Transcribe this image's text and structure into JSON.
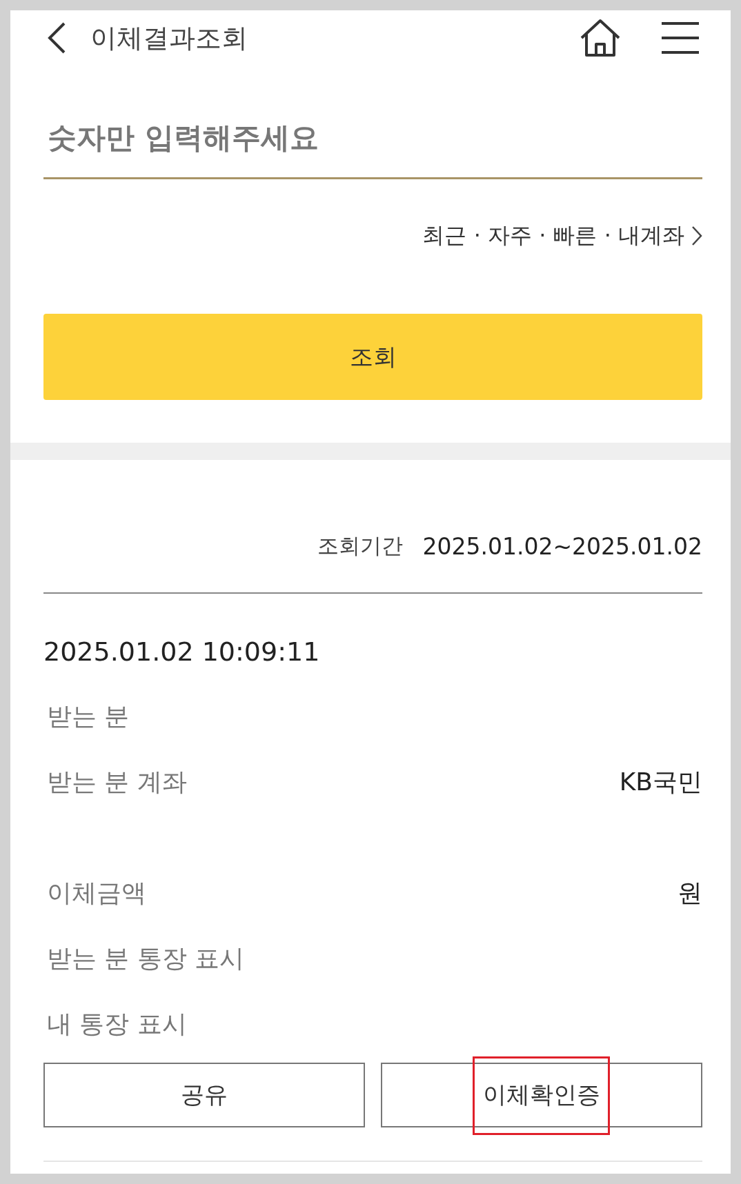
{
  "header": {
    "title": "이체결과조회"
  },
  "account_input": {
    "placeholder": "숫자만 입력해주세요"
  },
  "quick_links": {
    "items": [
      "최근",
      "자주",
      "빠른",
      "내계좌"
    ],
    "separator": "·"
  },
  "search_button": "조회",
  "period": {
    "label": "조회기간",
    "value": "2025.01.02~2025.01.02"
  },
  "result": {
    "datetime": "2025.01.02 10:09:11",
    "rows": [
      {
        "label": "받는 분",
        "value": ""
      },
      {
        "label": "받는 분 계좌",
        "value": "KB국민",
        "gap_after": true
      },
      {
        "label": "이체금액",
        "value": "원"
      },
      {
        "label": "받는 분 통장 표시",
        "value": ""
      },
      {
        "label": "내 통장 표시",
        "value": ""
      }
    ]
  },
  "buttons": [
    {
      "label": "공유",
      "highlighted": false
    },
    {
      "label": "이체확인증",
      "highlighted": true
    }
  ]
}
